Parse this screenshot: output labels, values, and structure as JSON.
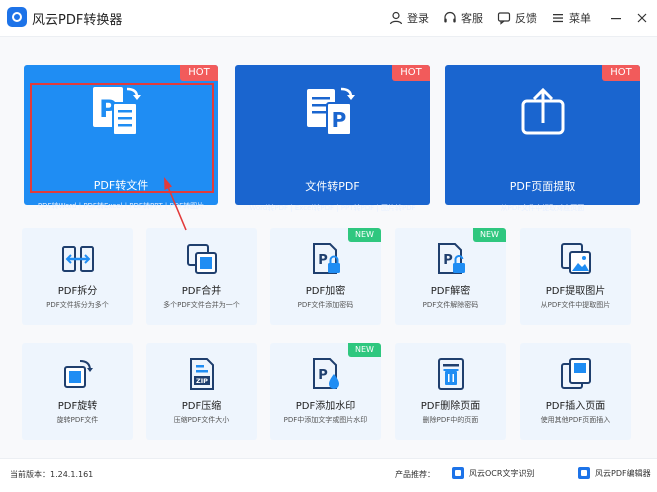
{
  "app": {
    "title": "风云PDF转换器"
  },
  "header": {
    "login_label": "登录",
    "service_label": "客服",
    "feedback_label": "反馈",
    "menu_label": "菜单"
  },
  "featured": [
    {
      "title": "PDF转文件",
      "subtitle": "PDF转Word | PDF转Excel | PDF转PPT | PDF转图片",
      "badge": "HOT"
    },
    {
      "title": "文件转PDF",
      "subtitle": "Word转PDF | Excel转PDF | PPT转PDF | 图片转PDF",
      "badge": "HOT"
    },
    {
      "title": "PDF页面提取",
      "subtitle": "从PDF文件中提取对应页面",
      "badge": "HOT"
    }
  ],
  "tools": [
    {
      "title": "PDF拆分",
      "subtitle": "PDF文件拆分为多个",
      "badge": ""
    },
    {
      "title": "PDF合并",
      "subtitle": "多个PDF文件合并为一个",
      "badge": ""
    },
    {
      "title": "PDF加密",
      "subtitle": "PDF文件添加密码",
      "badge": "NEW"
    },
    {
      "title": "PDF解密",
      "subtitle": "PDF文件解除密码",
      "badge": "NEW"
    },
    {
      "title": "PDF提取图片",
      "subtitle": "从PDF文件中提取图片",
      "badge": ""
    },
    {
      "title": "PDF旋转",
      "subtitle": "旋转PDF文件",
      "badge": ""
    },
    {
      "title": "PDF压缩",
      "subtitle": "压缩PDF文件大小",
      "badge": ""
    },
    {
      "title": "PDF添加水印",
      "subtitle": "PDF中添加文字或图片水印",
      "badge": "NEW"
    },
    {
      "title": "PDF删除页面",
      "subtitle": "删除PDF中的页面",
      "badge": ""
    },
    {
      "title": "PDF插入页面",
      "subtitle": "使用其他PDF页面插入",
      "badge": ""
    }
  ],
  "status": {
    "version": "当前版本：1.24.1.161",
    "recommend_label": "产品推荐：",
    "rec_ocr": "风云OCR文字识别",
    "rec_editor": "风云PDF编辑器"
  },
  "colors": {
    "primary": "#1f8df3",
    "dark_blue": "#1a65cf",
    "hot": "#f25b5b",
    "new": "#2fc77f",
    "highlight": "#e23b3b"
  }
}
